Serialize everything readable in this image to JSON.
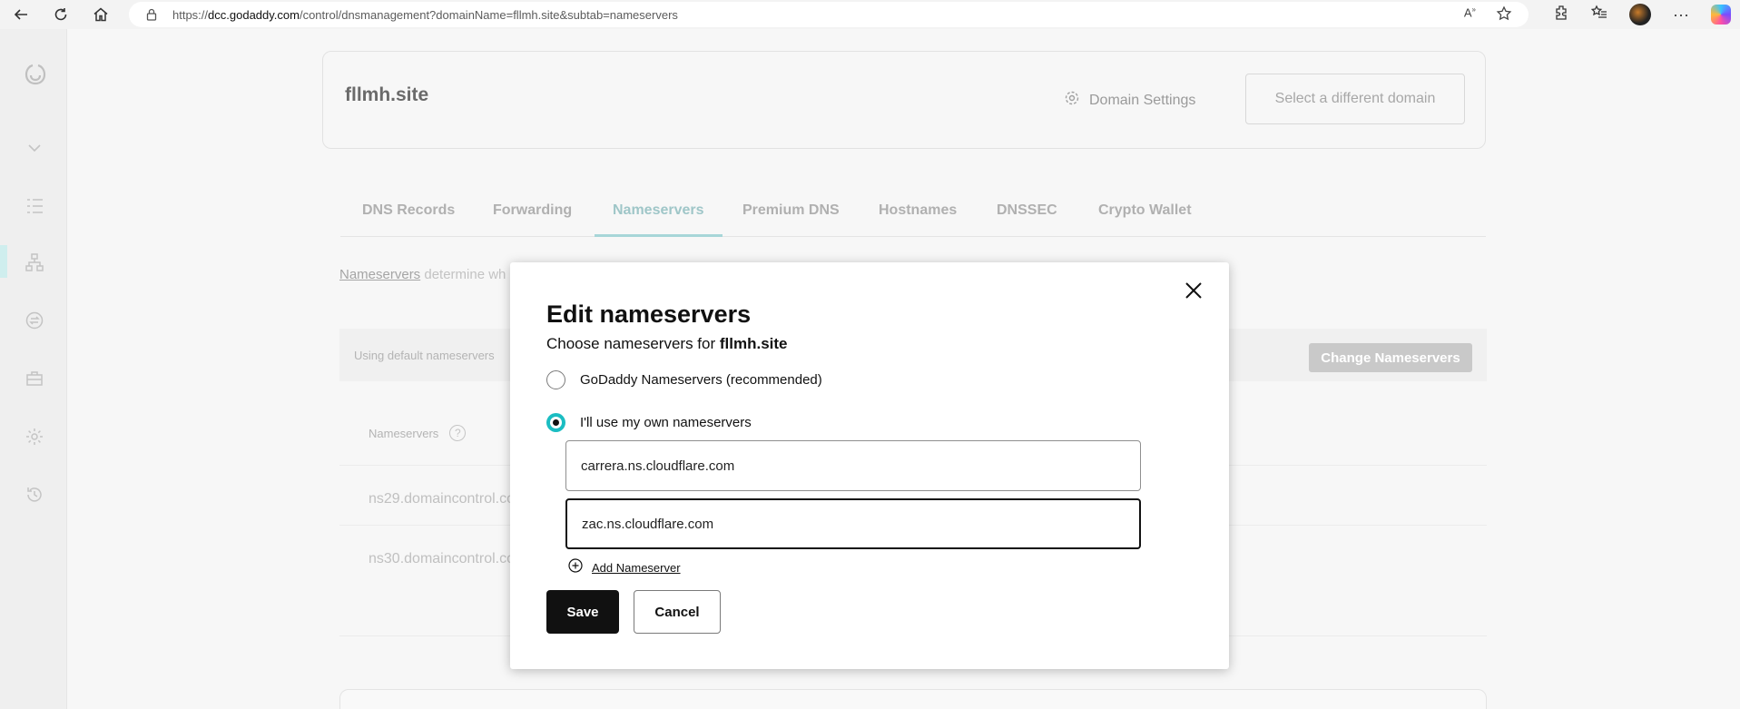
{
  "browser": {
    "url_prefix": "https://",
    "url_host": "dcc.godaddy.com",
    "url_rest": "/control/dnsmanagement?domainName=fllmh.site&subtab=nameservers"
  },
  "header": {
    "domain": "fllmh.site",
    "domain_settings_label": "Domain Settings",
    "select_domain_label": "Select a different domain"
  },
  "tabs": [
    {
      "label": "DNS Records"
    },
    {
      "label": "Forwarding"
    },
    {
      "label": "Nameservers"
    },
    {
      "label": "Premium DNS"
    },
    {
      "label": "Hostnames"
    },
    {
      "label": "DNSSEC"
    },
    {
      "label": "Crypto Wallet"
    }
  ],
  "background": {
    "intro_link": "Nameservers",
    "intro_rest": " determine wh",
    "default_text": "Using default nameservers",
    "change_button": "Change Nameservers",
    "ns_header": "Nameservers",
    "ns_rows": [
      "ns29.domaincontrol.co",
      "ns30.domaincontrol.co"
    ]
  },
  "modal": {
    "title": "Edit nameservers",
    "subtitle_prefix": "Choose nameservers for ",
    "subtitle_domain": "fllmh.site",
    "option_godaddy": "GoDaddy Nameservers (recommended)",
    "option_own": "I'll use my own nameservers",
    "own_selected": true,
    "nameservers": [
      "carrera.ns.cloudflare.com",
      "zac.ns.cloudflare.com"
    ],
    "add_label": "Add Nameserver",
    "save_label": "Save",
    "cancel_label": "Cancel"
  },
  "colors": {
    "accent": "#1bbdc2",
    "primary_button": "#111111"
  }
}
